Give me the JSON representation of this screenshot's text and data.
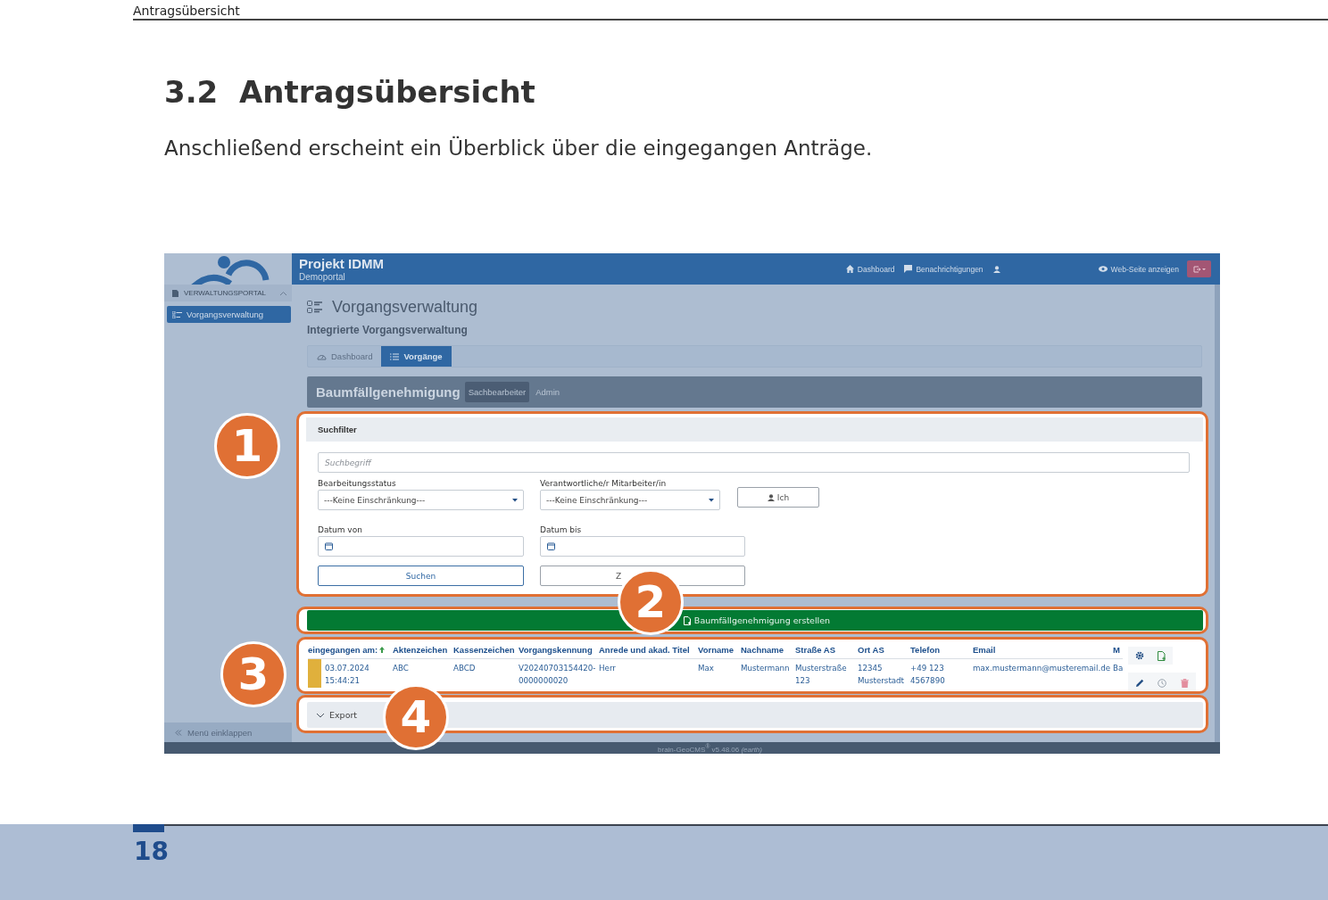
{
  "running_header": "Antragsübersicht",
  "section": {
    "number": "3.2",
    "title": "Antragsübersicht"
  },
  "intro": "Anschließend erscheint ein Überblick über die eingegangen Anträge.",
  "screenshot": {
    "app": {
      "title": "Projekt IDMM",
      "subtitle": "Demoportal"
    },
    "top_nav": [
      {
        "kind": "home",
        "label": "Dashboard"
      },
      {
        "kind": "chat",
        "label": "Benachrichtigungen"
      },
      {
        "kind": "user"
      }
    ],
    "web_link": "Web-Seite anzeigen",
    "sidebar": {
      "section": "VERWALTUNGSPORTAL",
      "expanded": true,
      "items": [
        {
          "label": "Vorgangsverwaltung",
          "selected": true
        }
      ],
      "collapse": "Menü einklappen"
    },
    "page_title": "Vorgangsverwaltung",
    "page_subtitle": "Integrierte Vorgangsverwaltung",
    "tabs": [
      {
        "kind": "dashboard",
        "label": "Dashboard",
        "selected": false
      },
      {
        "kind": "list",
        "label": "Vorgänge",
        "selected": true
      }
    ],
    "process": {
      "title": "Baumfällgenehmigung",
      "roles": [
        {
          "label": "Sachbearbeiter",
          "selected": true
        },
        {
          "label": "Admin",
          "selected": false
        }
      ]
    },
    "search_filter": {
      "title": "Suchfilter",
      "search_placeholder": "Suchbegriff",
      "status": {
        "label": "Bearbeitungsstatus",
        "value": "---Keine Einschränkung---"
      },
      "assignee": {
        "label": "Verantwortliche/r Mitarbeiter/in",
        "value": "---Keine Einschränkung---"
      },
      "me_button": "Ich",
      "date_from": {
        "label": "Datum von"
      },
      "date_to": {
        "label": "Datum bis"
      },
      "search_button": "Suchen",
      "reset_button": "Z"
    },
    "create_button": "Baumfällgenehmigung erstellen",
    "table": {
      "columns": [
        {
          "label": "eingegangen am:",
          "sorted": true
        },
        {
          "label": "Aktenzeichen",
          "sorted": false
        },
        {
          "label": "Kassenzeichen",
          "sorted": false
        },
        {
          "label": "Vorgangskennung",
          "sorted": false
        },
        {
          "label": "Anrede und akad. Titel",
          "sorted": false
        },
        {
          "label": "Vorname",
          "sorted": false
        },
        {
          "label": "Nachname",
          "sorted": false
        },
        {
          "label": "Straße AS",
          "sorted": false
        },
        {
          "label": "Ort AS",
          "sorted": false
        },
        {
          "label": "Telefon",
          "sorted": false
        },
        {
          "label": "Email",
          "sorted": false
        },
        {
          "label": "M",
          "sorted": false
        }
      ],
      "rows": [
        {
          "color": "#e0b03c",
          "cells": [
            "03.07.2024 15:44:21",
            "ABC",
            "ABCD",
            "V20240703154420-0000000020",
            "Herr",
            "Max",
            "Mustermann",
            "Musterstraße 123",
            "12345 Musterstadt",
            "+49 123 4567890",
            "max.mustermann@musteremail.de",
            "Ba"
          ]
        }
      ]
    },
    "export": {
      "label": "Export",
      "expanded": false
    },
    "footer": "brain-GeoCMS$^{®}$  v5.48.06 *(earth)*"
  },
  "callouts": [
    "1",
    "2",
    "3",
    "4"
  ],
  "page_number": "18"
}
